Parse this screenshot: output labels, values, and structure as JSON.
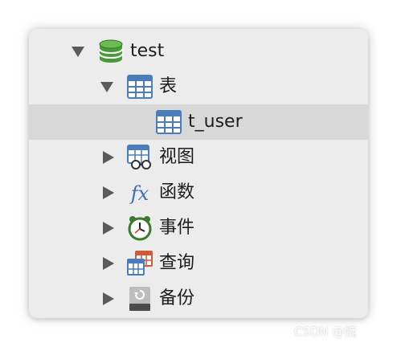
{
  "tree": {
    "database": {
      "label": "test",
      "expanded": true,
      "icon": "database-icon"
    },
    "tables_group": {
      "label": "表",
      "expanded": true,
      "icon": "table-icon"
    },
    "table_item": {
      "label": "t_user",
      "selected": true,
      "icon": "table-icon"
    },
    "views_group": {
      "label": "视图",
      "expanded": false,
      "icon": "view-icon"
    },
    "functions_group": {
      "label": "函数",
      "expanded": false,
      "icon": "function-icon"
    },
    "events_group": {
      "label": "事件",
      "expanded": false,
      "icon": "clock-icon"
    },
    "queries_group": {
      "label": "查询",
      "expanded": false,
      "icon": "query-icon"
    },
    "backups_group": {
      "label": "备份",
      "expanded": false,
      "icon": "backup-icon"
    }
  },
  "watermark": {
    "text": "CSDN @婉"
  },
  "colors": {
    "database_green": "#4a9a3a",
    "table_blue": "#4a7dbb",
    "query_red": "#cf5a3a",
    "selection_bg": "#d8d8d8",
    "panel_bg": "#ececec"
  }
}
